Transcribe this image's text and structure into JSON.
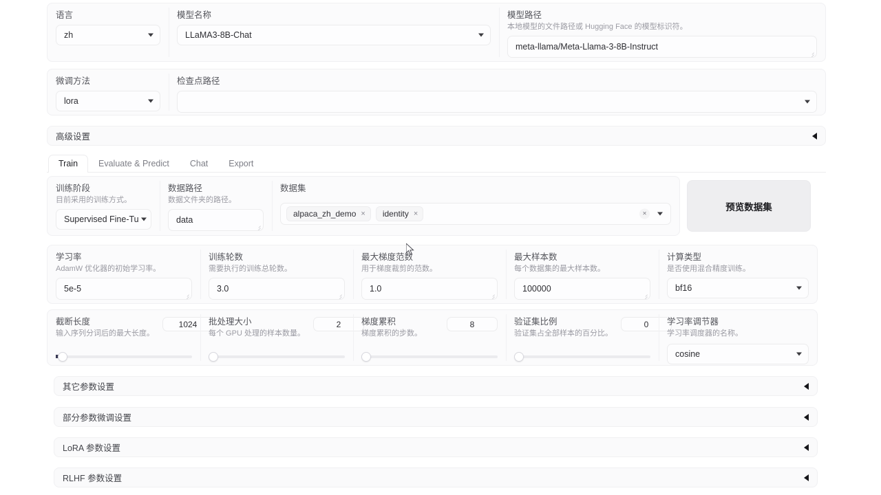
{
  "top_row": {
    "language": {
      "label": "语言",
      "value": "zh"
    },
    "model_name": {
      "label": "模型名称",
      "value": "LLaMA3-8B-Chat"
    },
    "model_path": {
      "label": "模型路径",
      "hint": "本地模型的文件路径或 Hugging Face 的模型标识符。",
      "value": "meta-llama/Meta-Llama-3-8B-Instruct"
    }
  },
  "second_row": {
    "finetune_method": {
      "label": "微调方法",
      "value": "lora"
    },
    "checkpoint_path": {
      "label": "检查点路径",
      "value": ""
    }
  },
  "advanced_accordion": {
    "label": "高级设置",
    "arrow": "triangle-left-icon"
  },
  "tabs": [
    {
      "label": "Train",
      "active": true
    },
    {
      "label": "Evaluate & Predict",
      "active": false
    },
    {
      "label": "Chat",
      "active": false
    },
    {
      "label": "Export",
      "active": false
    }
  ],
  "train_row1": {
    "stage": {
      "label": "训练阶段",
      "hint": "目前采用的训练方式。",
      "value": "Supervised Fine-Tuning"
    },
    "data_dir": {
      "label": "数据路径",
      "hint": "数据文件夹的路径。",
      "value": "data"
    },
    "dataset": {
      "label": "数据集",
      "tokens": [
        "alpaca_zh_demo",
        "identity"
      ],
      "token_remove": "×",
      "clear": "×"
    },
    "preview_button": {
      "label": "预览数据集"
    }
  },
  "train_row2": [
    {
      "label": "学习率",
      "hint": "AdamW 优化器的初始学习率。",
      "value": "5e-5",
      "type": "textbox"
    },
    {
      "label": "训练轮数",
      "hint": "需要执行的训练总轮数。",
      "value": "3.0",
      "type": "textbox"
    },
    {
      "label": "最大梯度范数",
      "hint": "用于梯度裁剪的范数。",
      "value": "1.0",
      "type": "textbox"
    },
    {
      "label": "最大样本数",
      "hint": "每个数据集的最大样本数。",
      "value": "100000",
      "type": "textbox"
    },
    {
      "label": "计算类型",
      "hint": "是否使用混合精度训练。",
      "value": "bf16",
      "type": "dropdown"
    }
  ],
  "train_row3": [
    {
      "label": "截断长度",
      "hint": "输入序列分词后的最大长度。",
      "value": "1024",
      "type": "slider",
      "percent": 4
    },
    {
      "label": "批处理大小",
      "hint": "每个 GPU 处理的样本数量。",
      "value": "2",
      "type": "slider",
      "percent": 1
    },
    {
      "label": "梯度累积",
      "hint": "梯度累积的步数。",
      "value": "8",
      "type": "slider",
      "percent": 1
    },
    {
      "label": "验证集比例",
      "hint": "验证集占全部样本的百分比。",
      "value": "0",
      "type": "slider",
      "percent": 0
    },
    {
      "label": "学习率调节器",
      "hint": "学习率调度器的名称。",
      "value": "cosine",
      "type": "dropdown"
    }
  ],
  "bottom_accordions": [
    {
      "label": "其它参数设置",
      "arrow": "triangle-left-icon"
    },
    {
      "label": "部分参数微调设置",
      "arrow": "triangle-left-icon"
    },
    {
      "label": "LoRA 参数设置",
      "arrow": "triangle-left-icon"
    },
    {
      "label": "RLHF 参数设置",
      "arrow": "triangle-left-icon"
    }
  ],
  "colors": {
    "page_bg": "#ffffff",
    "panel_bg": "#fbfbfc",
    "border": "#f0f0f2",
    "text": "#2e2e33",
    "muted": "#9b9ba3",
    "button_bg": "#eeeef0"
  }
}
